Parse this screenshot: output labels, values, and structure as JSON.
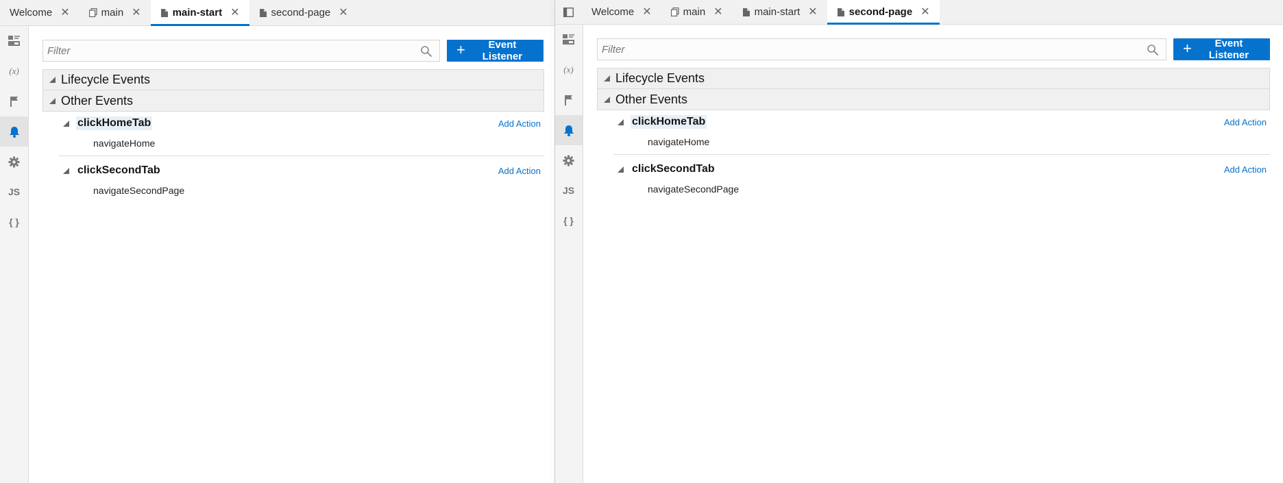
{
  "left": {
    "tabs": [
      {
        "label": "Welcome",
        "icon": "",
        "active": false
      },
      {
        "label": "main",
        "icon": "pages-icon",
        "active": false
      },
      {
        "label": "main-start",
        "icon": "page-icon",
        "active": true
      },
      {
        "label": "second-page",
        "icon": "page-icon",
        "active": false
      }
    ],
    "filter_placeholder": "Filter",
    "add_listener_label": "Event Listener",
    "sections": [
      "Lifecycle Events",
      "Other Events"
    ],
    "listeners": [
      {
        "name": "clickHomeTab",
        "action_link": "Add Action",
        "actions": [
          "navigateHome"
        ]
      },
      {
        "name": "clickSecondTab",
        "action_link": "Add Action",
        "actions": [
          "navigateSecondPage"
        ]
      }
    ]
  },
  "right": {
    "tabs": [
      {
        "label": "Welcome",
        "icon": "",
        "active": false
      },
      {
        "label": "main",
        "icon": "pages-icon",
        "active": false
      },
      {
        "label": "main-start",
        "icon": "page-icon",
        "active": false
      },
      {
        "label": "second-page",
        "icon": "page-icon",
        "active": true
      }
    ],
    "filter_placeholder": "Filter",
    "add_listener_label": "Event Listener",
    "sections": [
      "Lifecycle Events",
      "Other Events"
    ],
    "listeners": [
      {
        "name": "clickHomeTab",
        "action_link": "Add Action",
        "actions": [
          "navigateHome"
        ]
      },
      {
        "name": "clickSecondTab",
        "action_link": "Add Action",
        "actions": [
          "navigateSecondPage"
        ]
      }
    ]
  },
  "rail": {
    "items": [
      {
        "icon": "designer-icon",
        "active": false
      },
      {
        "icon": "variables-icon",
        "text": "(x)",
        "active": false
      },
      {
        "icon": "flag-icon",
        "active": false
      },
      {
        "icon": "bell-icon",
        "active": true
      },
      {
        "icon": "gear-icon",
        "active": false
      },
      {
        "icon": "js-icon",
        "text": "JS",
        "active": false
      },
      {
        "icon": "json-icon",
        "text": "{ }",
        "active": false
      }
    ]
  },
  "colors": {
    "accent": "#0572ce",
    "tab_bg": "#f1f1f1",
    "section_bg": "#f0f0f0"
  }
}
